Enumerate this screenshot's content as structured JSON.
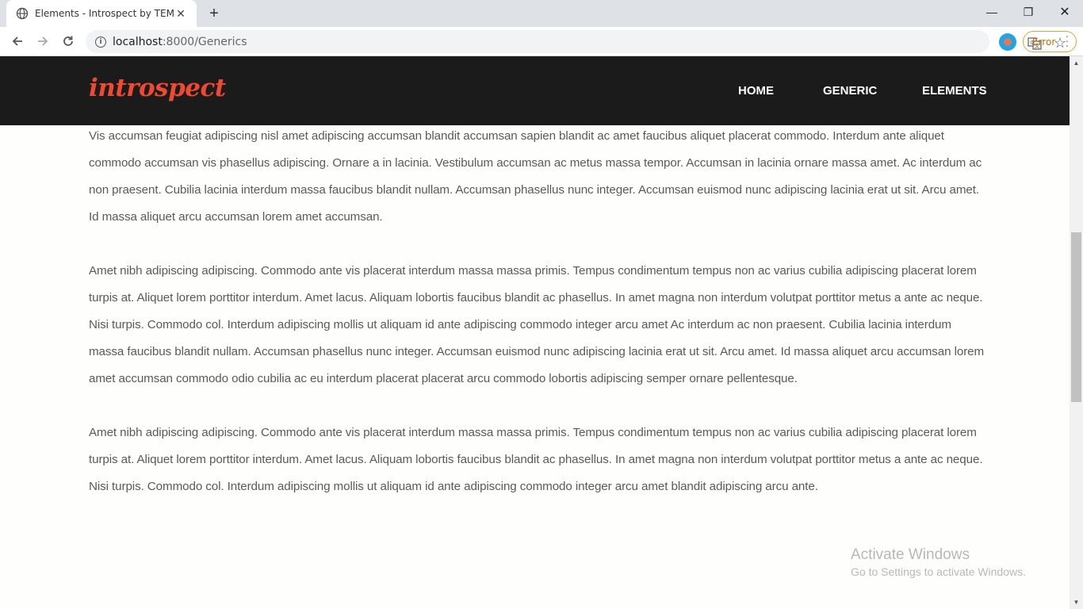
{
  "browser": {
    "tab_title": "Elements - Introspect by TEMPLA",
    "new_tab": "+",
    "url_host": "localhost",
    "url_path": ":8000/Generics",
    "error_label": "Error",
    "window_controls": {
      "minimize": "—",
      "maximize": "❐",
      "close": "✕"
    }
  },
  "site": {
    "logo": "introspect",
    "nav": {
      "home": "HOME",
      "generic": "GENERIC",
      "elements": "ELEMENTS"
    }
  },
  "content": {
    "paragraphs": [
      "Vis accumsan feugiat adipiscing nisl amet adipiscing accumsan blandit accumsan sapien blandit ac amet faucibus aliquet placerat commodo. Interdum ante aliquet commodo accumsan vis phasellus adipiscing. Ornare a in lacinia. Vestibulum accumsan ac metus massa tempor. Accumsan in lacinia ornare massa amet. Ac interdum ac non praesent. Cubilia lacinia interdum massa faucibus blandit nullam. Accumsan phasellus nunc integer. Accumsan euismod nunc adipiscing lacinia erat ut sit. Arcu amet. Id massa aliquet arcu accumsan lorem amet accumsan.",
      "Amet nibh adipiscing adipiscing. Commodo ante vis placerat interdum massa massa primis. Tempus condimentum tempus non ac varius cubilia adipiscing placerat lorem turpis at. Aliquet lorem porttitor interdum. Amet lacus. Aliquam lobortis faucibus blandit ac phasellus. In amet magna non interdum volutpat porttitor metus a ante ac neque. Nisi turpis. Commodo col. Interdum adipiscing mollis ut aliquam id ante adipiscing commodo integer arcu amet Ac interdum ac non praesent. Cubilia lacinia interdum massa faucibus blandit nullam. Accumsan phasellus nunc integer. Accumsan euismod nunc adipiscing lacinia erat ut sit. Arcu amet. Id massa aliquet arcu accumsan lorem amet accumsan commodo odio cubilia ac eu interdum placerat placerat arcu commodo lobortis adipiscing semper ornare pellentesque.",
      "Amet nibh adipiscing adipiscing. Commodo ante vis placerat interdum massa massa primis. Tempus condimentum tempus non ac varius cubilia adipiscing placerat lorem turpis at. Aliquet lorem porttitor interdum. Amet lacus. Aliquam lobortis faucibus blandit ac phasellus. In amet magna non interdum volutpat porttitor metus a ante ac neque. Nisi turpis. Commodo col. Interdum adipiscing mollis ut aliquam id ante adipiscing commodo integer arcu amet blandit adipiscing arcu ante."
    ]
  },
  "watermark": {
    "title": "Activate Windows",
    "subtitle": "Go to Settings to activate Windows."
  },
  "colors": {
    "header_bg": "#1b1b1b",
    "logo": "#ef4a31",
    "error_accent": "#e8a135"
  },
  "icons": [
    "globe-icon",
    "close-icon",
    "back-arrow-icon",
    "forward-arrow-icon",
    "reload-icon",
    "info-icon",
    "translate-icon",
    "star-icon",
    "profile-icon",
    "more-vert-icon"
  ]
}
